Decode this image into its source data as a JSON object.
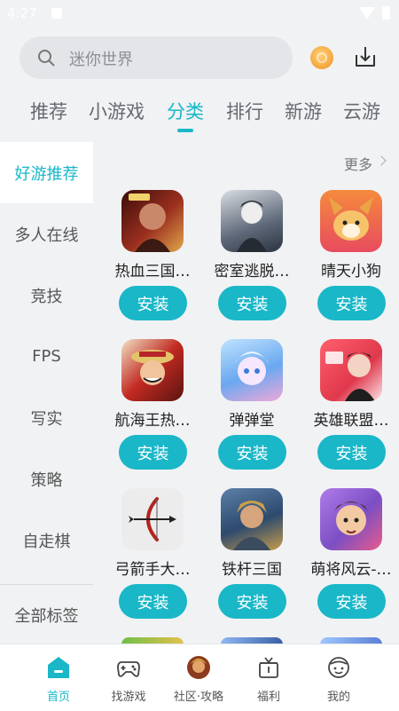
{
  "status_bar": {
    "time": "4:27"
  },
  "search": {
    "placeholder": "迷你世界"
  },
  "tabs": [
    {
      "label": "推荐",
      "active": false
    },
    {
      "label": "小游戏",
      "active": false
    },
    {
      "label": "分类",
      "active": true
    },
    {
      "label": "排行",
      "active": false
    },
    {
      "label": "新游",
      "active": false
    },
    {
      "label": "云游",
      "active": false
    }
  ],
  "sidebar": {
    "items": [
      {
        "label": "好游推荐",
        "active": true
      },
      {
        "label": "多人在线",
        "active": false
      },
      {
        "label": "竞技",
        "active": false
      },
      {
        "label": "FPS",
        "active": false
      },
      {
        "label": "写实",
        "active": false
      },
      {
        "label": "策略",
        "active": false
      },
      {
        "label": "自走棋",
        "active": false
      }
    ],
    "all_tags": "全部标签"
  },
  "more": "更多",
  "install_label": "安装",
  "games": [
    {
      "name": "热血三国…",
      "icon": "hot-blood-three-kingdoms-icon",
      "color": "#8a2a1c"
    },
    {
      "name": "密室逃脱…",
      "icon": "escape-room-icon",
      "color": "#3c4656"
    },
    {
      "name": "晴天小狗",
      "icon": "sunny-puppy-icon",
      "color": "#f59a3a"
    },
    {
      "name": "航海王热…",
      "icon": "one-piece-icon",
      "color": "#b3241d"
    },
    {
      "name": "弹弹堂",
      "icon": "ddtank-icon",
      "color": "#6aa8f0"
    },
    {
      "name": "英雄联盟…",
      "icon": "league-of-legends-icon",
      "color": "#e84b5a"
    },
    {
      "name": "弓箭手大…",
      "icon": "archer-icon",
      "color": "#ececec"
    },
    {
      "name": "铁杆三国",
      "icon": "iron-three-kingdoms-icon",
      "color": "#2d4a6e"
    },
    {
      "name": "萌将风云-…",
      "icon": "cute-generals-icon",
      "color": "#7b4fc4"
    }
  ],
  "bottom_nav": [
    {
      "label": "首页",
      "icon": "home-icon",
      "active": true
    },
    {
      "label": "找游戏",
      "icon": "gamepad-icon",
      "active": false
    },
    {
      "label": "社区·攻略",
      "icon": "community-avatar-icon",
      "active": false
    },
    {
      "label": "福利",
      "icon": "gift-icon",
      "active": false
    },
    {
      "label": "我的",
      "icon": "profile-icon",
      "active": false
    }
  ],
  "colors": {
    "accent": "#19b7c8",
    "background": "#f1f2f4"
  }
}
